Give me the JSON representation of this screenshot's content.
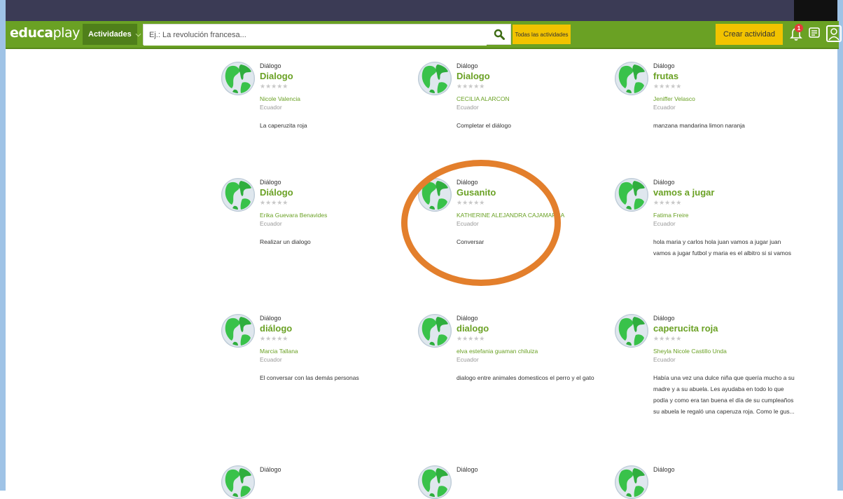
{
  "header": {
    "logo_prefix": "educa",
    "logo_suffix": "play",
    "activities_label": "Actividades",
    "search_placeholder": "Ej.: La revolución francesa...",
    "all_activities_label": "Todas las actividades",
    "create_label": "Crear actividad",
    "notification_count": "1"
  },
  "cards": [
    {
      "type": "Diálogo",
      "title": "Dialogo",
      "author": "Nicole Valencia",
      "country": "Ecuador",
      "desc": "La caperuzita roja"
    },
    {
      "type": "Diálogo",
      "title": "Dialogo",
      "author": "CECILIA ALARCON",
      "country": "Ecuador",
      "desc": "Completar el diálogo"
    },
    {
      "type": "Diálogo",
      "title": "frutas",
      "author": "Jeniffer Velasco",
      "country": "Ecuador",
      "desc": "manzana mandarina limon naranja"
    },
    {
      "type": "Diálogo",
      "title": "Diálogo",
      "author": "Erika Guevara Benavides",
      "country": "Ecuador",
      "desc": "Realizar un dialogo"
    },
    {
      "type": "Diálogo",
      "title": "Gusanito",
      "author": "KATHERINE ALEJANDRA CAJAMARCA",
      "country": "Ecuador",
      "desc": "Conversar"
    },
    {
      "type": "Diálogo",
      "title": "vamos a jugar",
      "author": "Fatima Freire",
      "country": "Ecuador",
      "desc": "hola maria y carlos hola juan vamos a jugar juan vamos a jugar futbol y maria es el albitro si si vamos"
    },
    {
      "type": "Diálogo",
      "title": "diálogo",
      "author": "Marcia Tallana",
      "country": "Ecuador",
      "desc": "El conversar con las demás personas"
    },
    {
      "type": "Diálogo",
      "title": "dialogo",
      "author": "elva estefania guaman chiluiza",
      "country": "Ecuador",
      "desc": "dialogo entre animales domesticos el perro y el gato"
    },
    {
      "type": "Diálogo",
      "title": "caperucita roja",
      "author": "Sheyla Nicole Castillo Unda",
      "country": "Ecuador",
      "desc": "Había una vez una dulce niña que quería mucho a su madre y a su abuela. Les ayudaba en todo lo que podía y como era tan buena el día de su cumpleaños su abuela le regaló una caperuza roja. Como le gus..."
    },
    {
      "type": "Diálogo",
      "title": "",
      "author": "",
      "country": "",
      "desc": ""
    },
    {
      "type": "Diálogo",
      "title": "",
      "author": "",
      "country": "",
      "desc": ""
    },
    {
      "type": "Diálogo",
      "title": "",
      "author": "",
      "country": "",
      "desc": ""
    }
  ],
  "stars": "★★★★★",
  "colors": {
    "brand_green": "#6aa124",
    "dark_green": "#4f7f1a",
    "yellow": "#f2c300",
    "highlight_orange": "#e37f2c",
    "frame_blue": "#9fc3e6"
  }
}
